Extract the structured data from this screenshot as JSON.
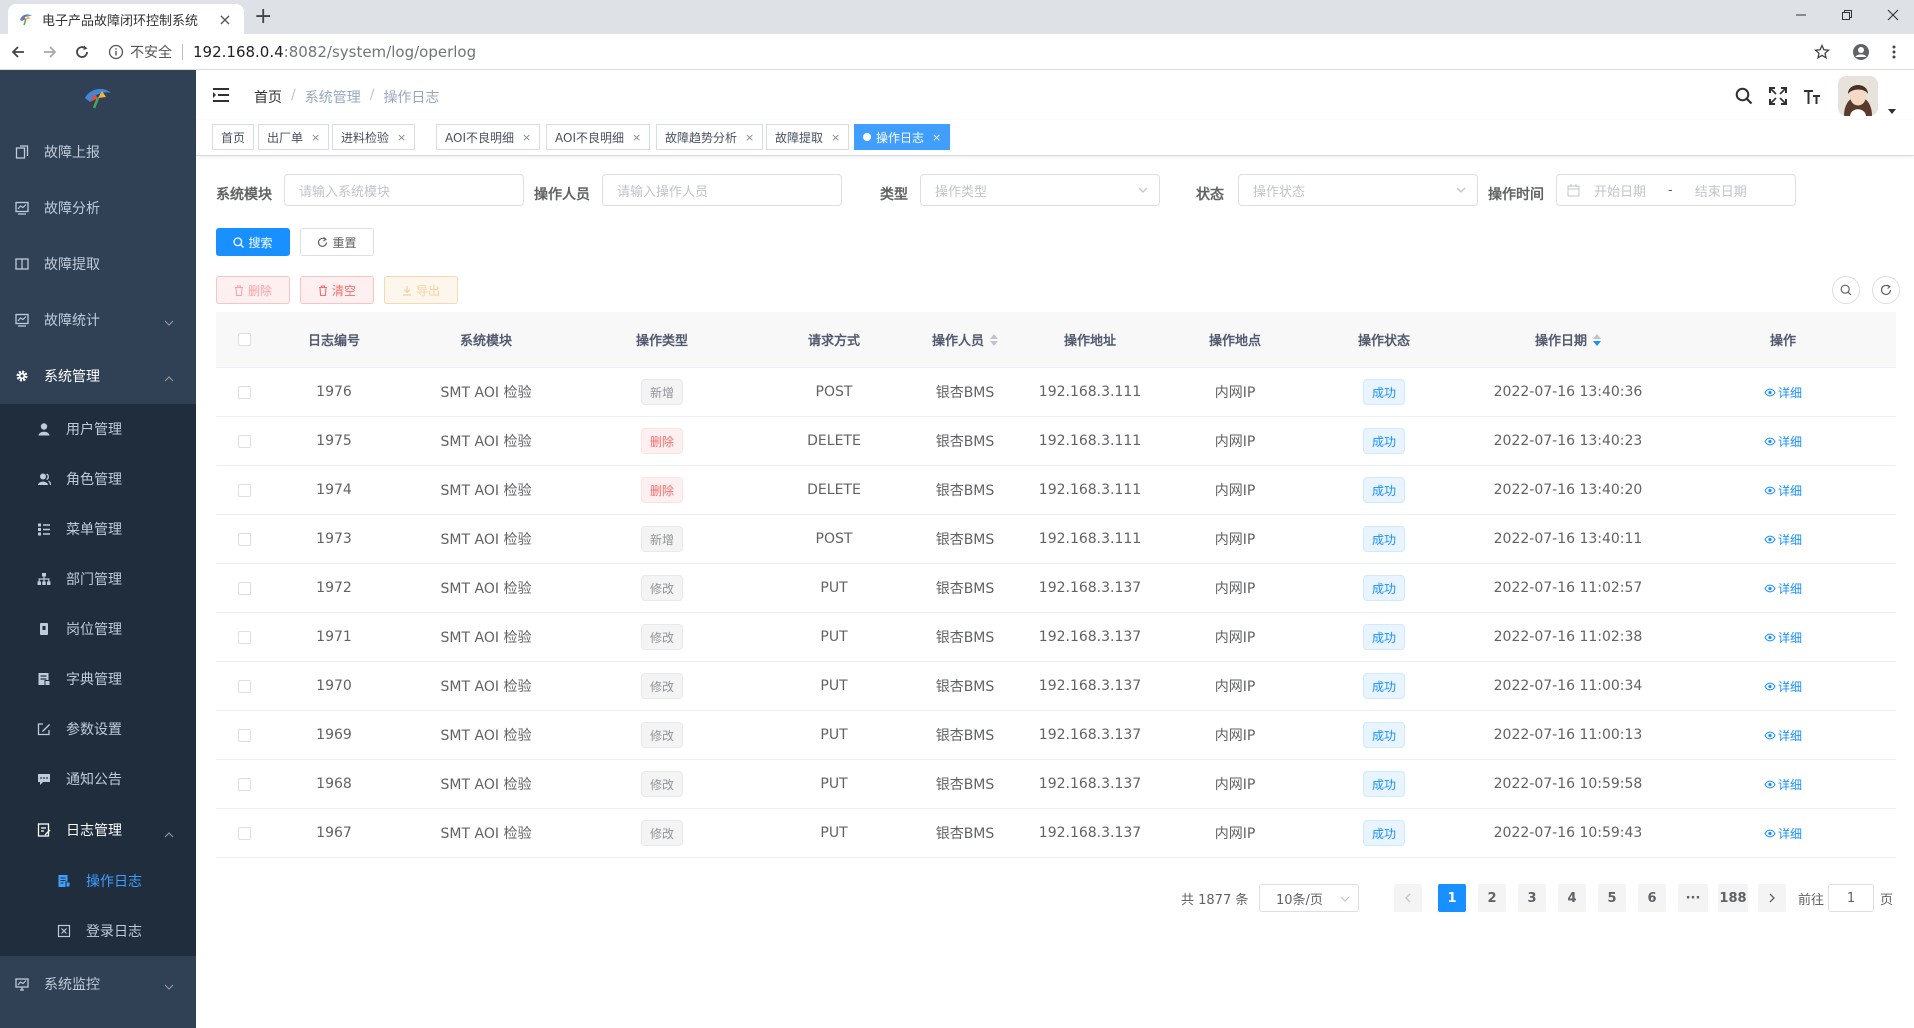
{
  "browser": {
    "tab_title": "电子产品故障闭环控制系统",
    "insecure_label": "不安全",
    "url_host": "192.168.0.4",
    "url_path": ":8082/system/log/operlog"
  },
  "sidebar": {
    "items": [
      {
        "label": "故障上报",
        "icon": "upload-icon"
      },
      {
        "label": "故障分析",
        "icon": "chart-icon"
      },
      {
        "label": "故障提取",
        "icon": "table-icon"
      },
      {
        "label": "故障统计",
        "icon": "chart-icon"
      },
      {
        "label": "系统管理",
        "icon": "gear-icon"
      }
    ],
    "system_children": [
      {
        "label": "用户管理",
        "icon": "user-icon"
      },
      {
        "label": "角色管理",
        "icon": "peoples-icon"
      },
      {
        "label": "菜单管理",
        "icon": "tree-table-icon"
      },
      {
        "label": "部门管理",
        "icon": "tree-icon"
      },
      {
        "label": "岗位管理",
        "icon": "post-icon"
      },
      {
        "label": "字典管理",
        "icon": "dict-icon"
      },
      {
        "label": "参数设置",
        "icon": "edit-icon"
      },
      {
        "label": "通知公告",
        "icon": "message-icon"
      },
      {
        "label": "日志管理",
        "icon": "log-icon"
      }
    ],
    "log_children": [
      {
        "label": "操作日志",
        "icon": "form-icon"
      },
      {
        "label": "登录日志",
        "icon": "logininfor-icon"
      }
    ],
    "monitor": {
      "label": "系统监控",
      "icon": "monitor-icon"
    }
  },
  "breadcrumb": [
    "首页",
    "系统管理",
    "操作日志"
  ],
  "tags": [
    "首页",
    "出厂单",
    "进料检验",
    "AOI不良明细",
    "AOI不良明细",
    "故障趋势分析",
    "故障提取",
    "操作日志"
  ],
  "form": {
    "module_label": "系统模块",
    "module_placeholder": "请输入系统模块",
    "operator_label": "操作人员",
    "operator_placeholder": "请输入操作人员",
    "type_label": "类型",
    "type_placeholder": "操作类型",
    "status_label": "状态",
    "status_placeholder": "操作状态",
    "time_label": "操作时间",
    "start_placeholder": "开始日期",
    "range_sep": "-",
    "end_placeholder": "结束日期",
    "search_label": "搜索",
    "reset_label": "重置",
    "delete_label": "删除",
    "clean_label": "清空",
    "export_label": "导出"
  },
  "table": {
    "headers": [
      "日志编号",
      "系统模块",
      "操作类型",
      "请求方式",
      "操作人员",
      "操作地址",
      "操作地点",
      "操作状态",
      "操作日期",
      "操作"
    ],
    "detail_label": "详细",
    "rows": [
      {
        "id": "1976",
        "module": "SMT AOI 检验",
        "type": "新增",
        "type_style": "info",
        "method": "POST",
        "operator": "银杏BMS",
        "ip": "192.168.3.111",
        "location": "内网IP",
        "status": "成功",
        "time": "2022-07-16 13:40:36"
      },
      {
        "id": "1975",
        "module": "SMT AOI 检验",
        "type": "删除",
        "type_style": "danger",
        "method": "DELETE",
        "operator": "银杏BMS",
        "ip": "192.168.3.111",
        "location": "内网IP",
        "status": "成功",
        "time": "2022-07-16 13:40:23"
      },
      {
        "id": "1974",
        "module": "SMT AOI 检验",
        "type": "删除",
        "type_style": "danger",
        "method": "DELETE",
        "operator": "银杏BMS",
        "ip": "192.168.3.111",
        "location": "内网IP",
        "status": "成功",
        "time": "2022-07-16 13:40:20"
      },
      {
        "id": "1973",
        "module": "SMT AOI 检验",
        "type": "新增",
        "type_style": "info",
        "method": "POST",
        "operator": "银杏BMS",
        "ip": "192.168.3.111",
        "location": "内网IP",
        "status": "成功",
        "time": "2022-07-16 13:40:11"
      },
      {
        "id": "1972",
        "module": "SMT AOI 检验",
        "type": "修改",
        "type_style": "info",
        "method": "PUT",
        "operator": "银杏BMS",
        "ip": "192.168.3.137",
        "location": "内网IP",
        "status": "成功",
        "time": "2022-07-16 11:02:57"
      },
      {
        "id": "1971",
        "module": "SMT AOI 检验",
        "type": "修改",
        "type_style": "info",
        "method": "PUT",
        "operator": "银杏BMS",
        "ip": "192.168.3.137",
        "location": "内网IP",
        "status": "成功",
        "time": "2022-07-16 11:02:38"
      },
      {
        "id": "1970",
        "module": "SMT AOI 检验",
        "type": "修改",
        "type_style": "info",
        "method": "PUT",
        "operator": "银杏BMS",
        "ip": "192.168.3.137",
        "location": "内网IP",
        "status": "成功",
        "time": "2022-07-16 11:00:34"
      },
      {
        "id": "1969",
        "module": "SMT AOI 检验",
        "type": "修改",
        "type_style": "info",
        "method": "PUT",
        "operator": "银杏BMS",
        "ip": "192.168.3.137",
        "location": "内网IP",
        "status": "成功",
        "time": "2022-07-16 11:00:13"
      },
      {
        "id": "1968",
        "module": "SMT AOI 检验",
        "type": "修改",
        "type_style": "info",
        "method": "PUT",
        "operator": "银杏BMS",
        "ip": "192.168.3.137",
        "location": "内网IP",
        "status": "成功",
        "time": "2022-07-16 10:59:58"
      },
      {
        "id": "1967",
        "module": "SMT AOI 检验",
        "type": "修改",
        "type_style": "info",
        "method": "PUT",
        "operator": "银杏BMS",
        "ip": "192.168.3.137",
        "location": "内网IP",
        "status": "成功",
        "time": "2022-07-16 10:59:43"
      }
    ]
  },
  "pagination": {
    "total": "共 1877 条",
    "page_size": "10条/页",
    "pages": [
      "1",
      "2",
      "3",
      "4",
      "5",
      "6",
      "···",
      "188"
    ],
    "current": "1",
    "goto_prefix": "前往",
    "goto_value": "1",
    "goto_suffix": "页"
  },
  "colors": {
    "sidebar_bg": "#304156",
    "submenu_bg": "#1f2d3d",
    "primary": "#1890ff",
    "active_menu": "#409eff"
  }
}
